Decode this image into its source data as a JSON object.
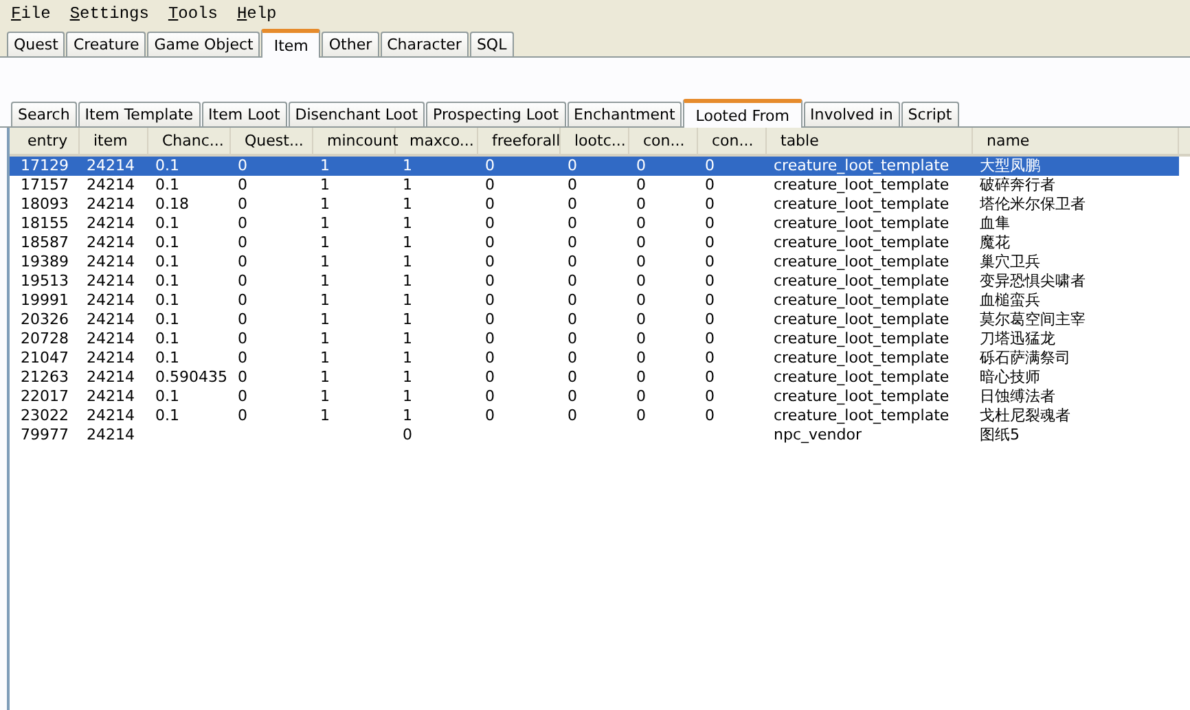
{
  "menu": [
    "File",
    "Settings",
    "Tools",
    "Help"
  ],
  "tabs": [
    {
      "label": "Quest",
      "selected": false
    },
    {
      "label": "Creature",
      "selected": false
    },
    {
      "label": "Game Object",
      "selected": false
    },
    {
      "label": "Item",
      "selected": true
    },
    {
      "label": "Other",
      "selected": false
    },
    {
      "label": "Character",
      "selected": false
    },
    {
      "label": "SQL",
      "selected": false
    }
  ],
  "subtabs": [
    {
      "label": "Search",
      "selected": false
    },
    {
      "label": "Item Template",
      "selected": false
    },
    {
      "label": "Item Loot",
      "selected": false
    },
    {
      "label": "Disenchant Loot",
      "selected": false
    },
    {
      "label": "Prospecting Loot",
      "selected": false
    },
    {
      "label": "Enchantment",
      "selected": false
    },
    {
      "label": "Looted From",
      "selected": true
    },
    {
      "label": "Involved in",
      "selected": false
    },
    {
      "label": "Script",
      "selected": false
    }
  ],
  "table": {
    "columns": [
      "entry",
      "item",
      "Chanc...",
      "Quest...",
      "mincount",
      "maxco...",
      "freeforall",
      "lootc...",
      "con...",
      "con...",
      "table",
      "name"
    ],
    "rows": [
      {
        "selected": true,
        "cells": [
          "17129",
          "24214",
          "0.1",
          "0",
          "1",
          "1",
          "0",
          "0",
          "0",
          "0",
          "creature_loot_template",
          "大型凤鹏"
        ]
      },
      {
        "selected": false,
        "cells": [
          "17157",
          "24214",
          "0.1",
          "0",
          "1",
          "1",
          "0",
          "0",
          "0",
          "0",
          "creature_loot_template",
          "破碎奔行者"
        ]
      },
      {
        "selected": false,
        "cells": [
          "18093",
          "24214",
          "0.18",
          "0",
          "1",
          "1",
          "0",
          "0",
          "0",
          "0",
          "creature_loot_template",
          "塔伦米尔保卫者"
        ]
      },
      {
        "selected": false,
        "cells": [
          "18155",
          "24214",
          "0.1",
          "0",
          "1",
          "1",
          "0",
          "0",
          "0",
          "0",
          "creature_loot_template",
          "血隼"
        ]
      },
      {
        "selected": false,
        "cells": [
          "18587",
          "24214",
          "0.1",
          "0",
          "1",
          "1",
          "0",
          "0",
          "0",
          "0",
          "creature_loot_template",
          "魔花"
        ]
      },
      {
        "selected": false,
        "cells": [
          "19389",
          "24214",
          "0.1",
          "0",
          "1",
          "1",
          "0",
          "0",
          "0",
          "0",
          "creature_loot_template",
          "巢穴卫兵"
        ]
      },
      {
        "selected": false,
        "cells": [
          "19513",
          "24214",
          "0.1",
          "0",
          "1",
          "1",
          "0",
          "0",
          "0",
          "0",
          "creature_loot_template",
          "变异恐惧尖啸者"
        ]
      },
      {
        "selected": false,
        "cells": [
          "19991",
          "24214",
          "0.1",
          "0",
          "1",
          "1",
          "0",
          "0",
          "0",
          "0",
          "creature_loot_template",
          "血槌蛮兵"
        ]
      },
      {
        "selected": false,
        "cells": [
          "20326",
          "24214",
          "0.1",
          "0",
          "1",
          "1",
          "0",
          "0",
          "0",
          "0",
          "creature_loot_template",
          "莫尔葛空间主宰"
        ]
      },
      {
        "selected": false,
        "cells": [
          "20728",
          "24214",
          "0.1",
          "0",
          "1",
          "1",
          "0",
          "0",
          "0",
          "0",
          "creature_loot_template",
          "刀塔迅猛龙"
        ]
      },
      {
        "selected": false,
        "cells": [
          "21047",
          "24214",
          "0.1",
          "0",
          "1",
          "1",
          "0",
          "0",
          "0",
          "0",
          "creature_loot_template",
          "砾石萨满祭司"
        ]
      },
      {
        "selected": false,
        "cells": [
          "21263",
          "24214",
          "0.590435",
          "0",
          "1",
          "1",
          "0",
          "0",
          "0",
          "0",
          "creature_loot_template",
          "暗心技师"
        ]
      },
      {
        "selected": false,
        "cells": [
          "22017",
          "24214",
          "0.1",
          "0",
          "1",
          "1",
          "0",
          "0",
          "0",
          "0",
          "creature_loot_template",
          "日蚀缚法者"
        ]
      },
      {
        "selected": false,
        "cells": [
          "23022",
          "24214",
          "0.1",
          "0",
          "1",
          "1",
          "0",
          "0",
          "0",
          "0",
          "creature_loot_template",
          "戈杜尼裂魂者"
        ]
      },
      {
        "selected": false,
        "cells": [
          "79977",
          "24214",
          null,
          null,
          null,
          "0",
          null,
          null,
          null,
          null,
          "npc_vendor",
          "图纸5"
        ]
      }
    ]
  }
}
